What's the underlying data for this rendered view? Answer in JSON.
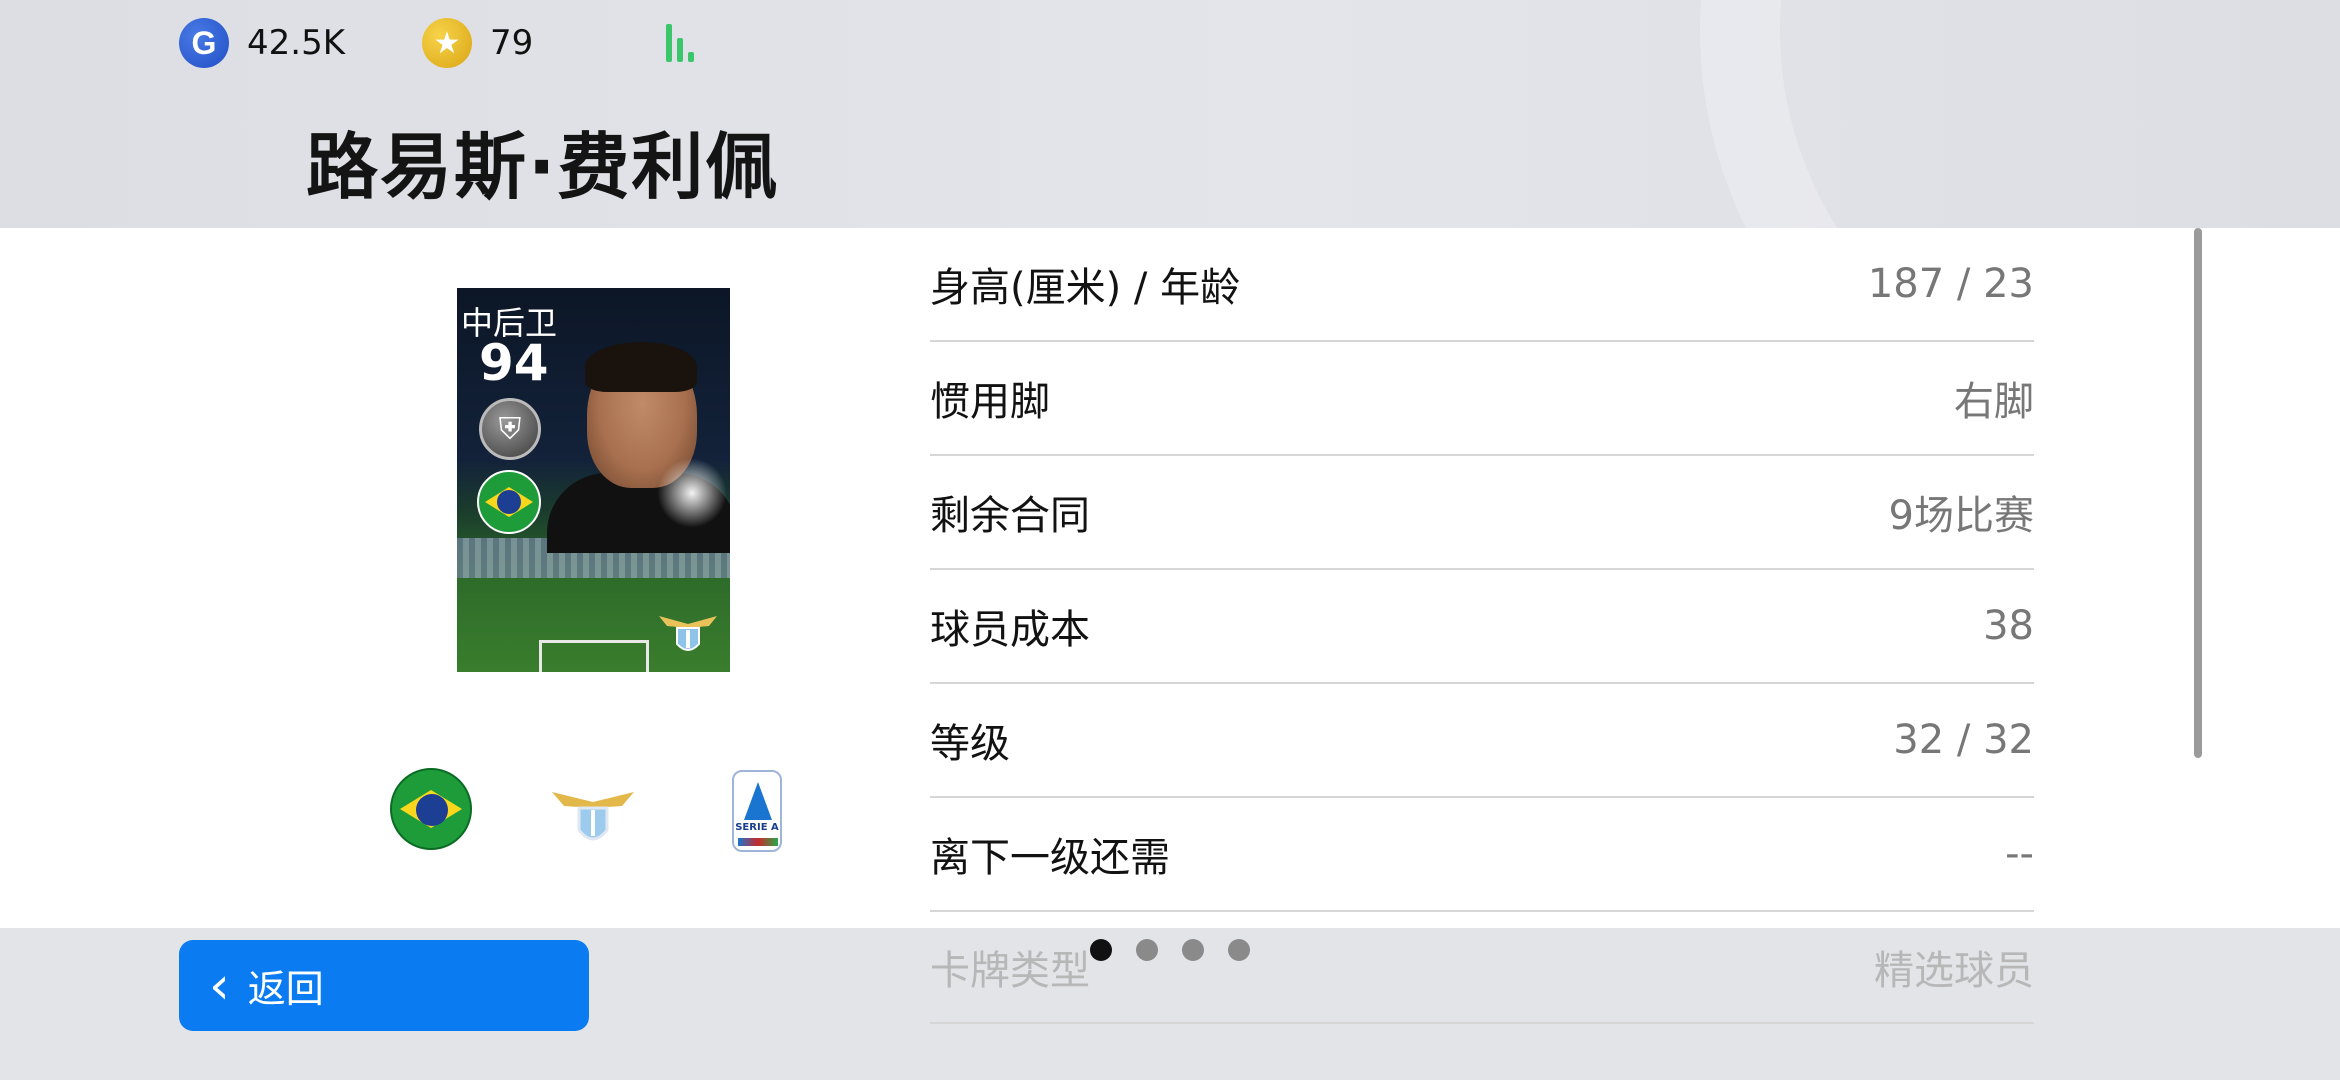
{
  "header": {
    "gp": "42.5K",
    "coins": "79",
    "player_name": "路易斯·费利佩"
  },
  "card": {
    "position": "中后卫",
    "rating": "94"
  },
  "stats": [
    {
      "label": "身高(厘米) / 年龄",
      "value": "187 / 23"
    },
    {
      "label": "惯用脚",
      "value": "右脚"
    },
    {
      "label": "剩余合同",
      "value": "9场比赛"
    },
    {
      "label": "球员成本",
      "value": "38"
    },
    {
      "label": "等级",
      "value": "32 / 32"
    },
    {
      "label": "离下一级还需",
      "value": "--"
    },
    {
      "label": "卡牌类型",
      "value": "精选球员"
    }
  ],
  "league_badge": "SERIE A",
  "pagination": {
    "total": 4,
    "active": 1
  },
  "footer": {
    "back_label": "返回"
  },
  "colors": {
    "accent": "#0b7bf2",
    "signal": "#3cc66b"
  },
  "icons": [
    "gp-icon",
    "coin-icon",
    "signal-icon",
    "chevron-left-icon"
  ]
}
